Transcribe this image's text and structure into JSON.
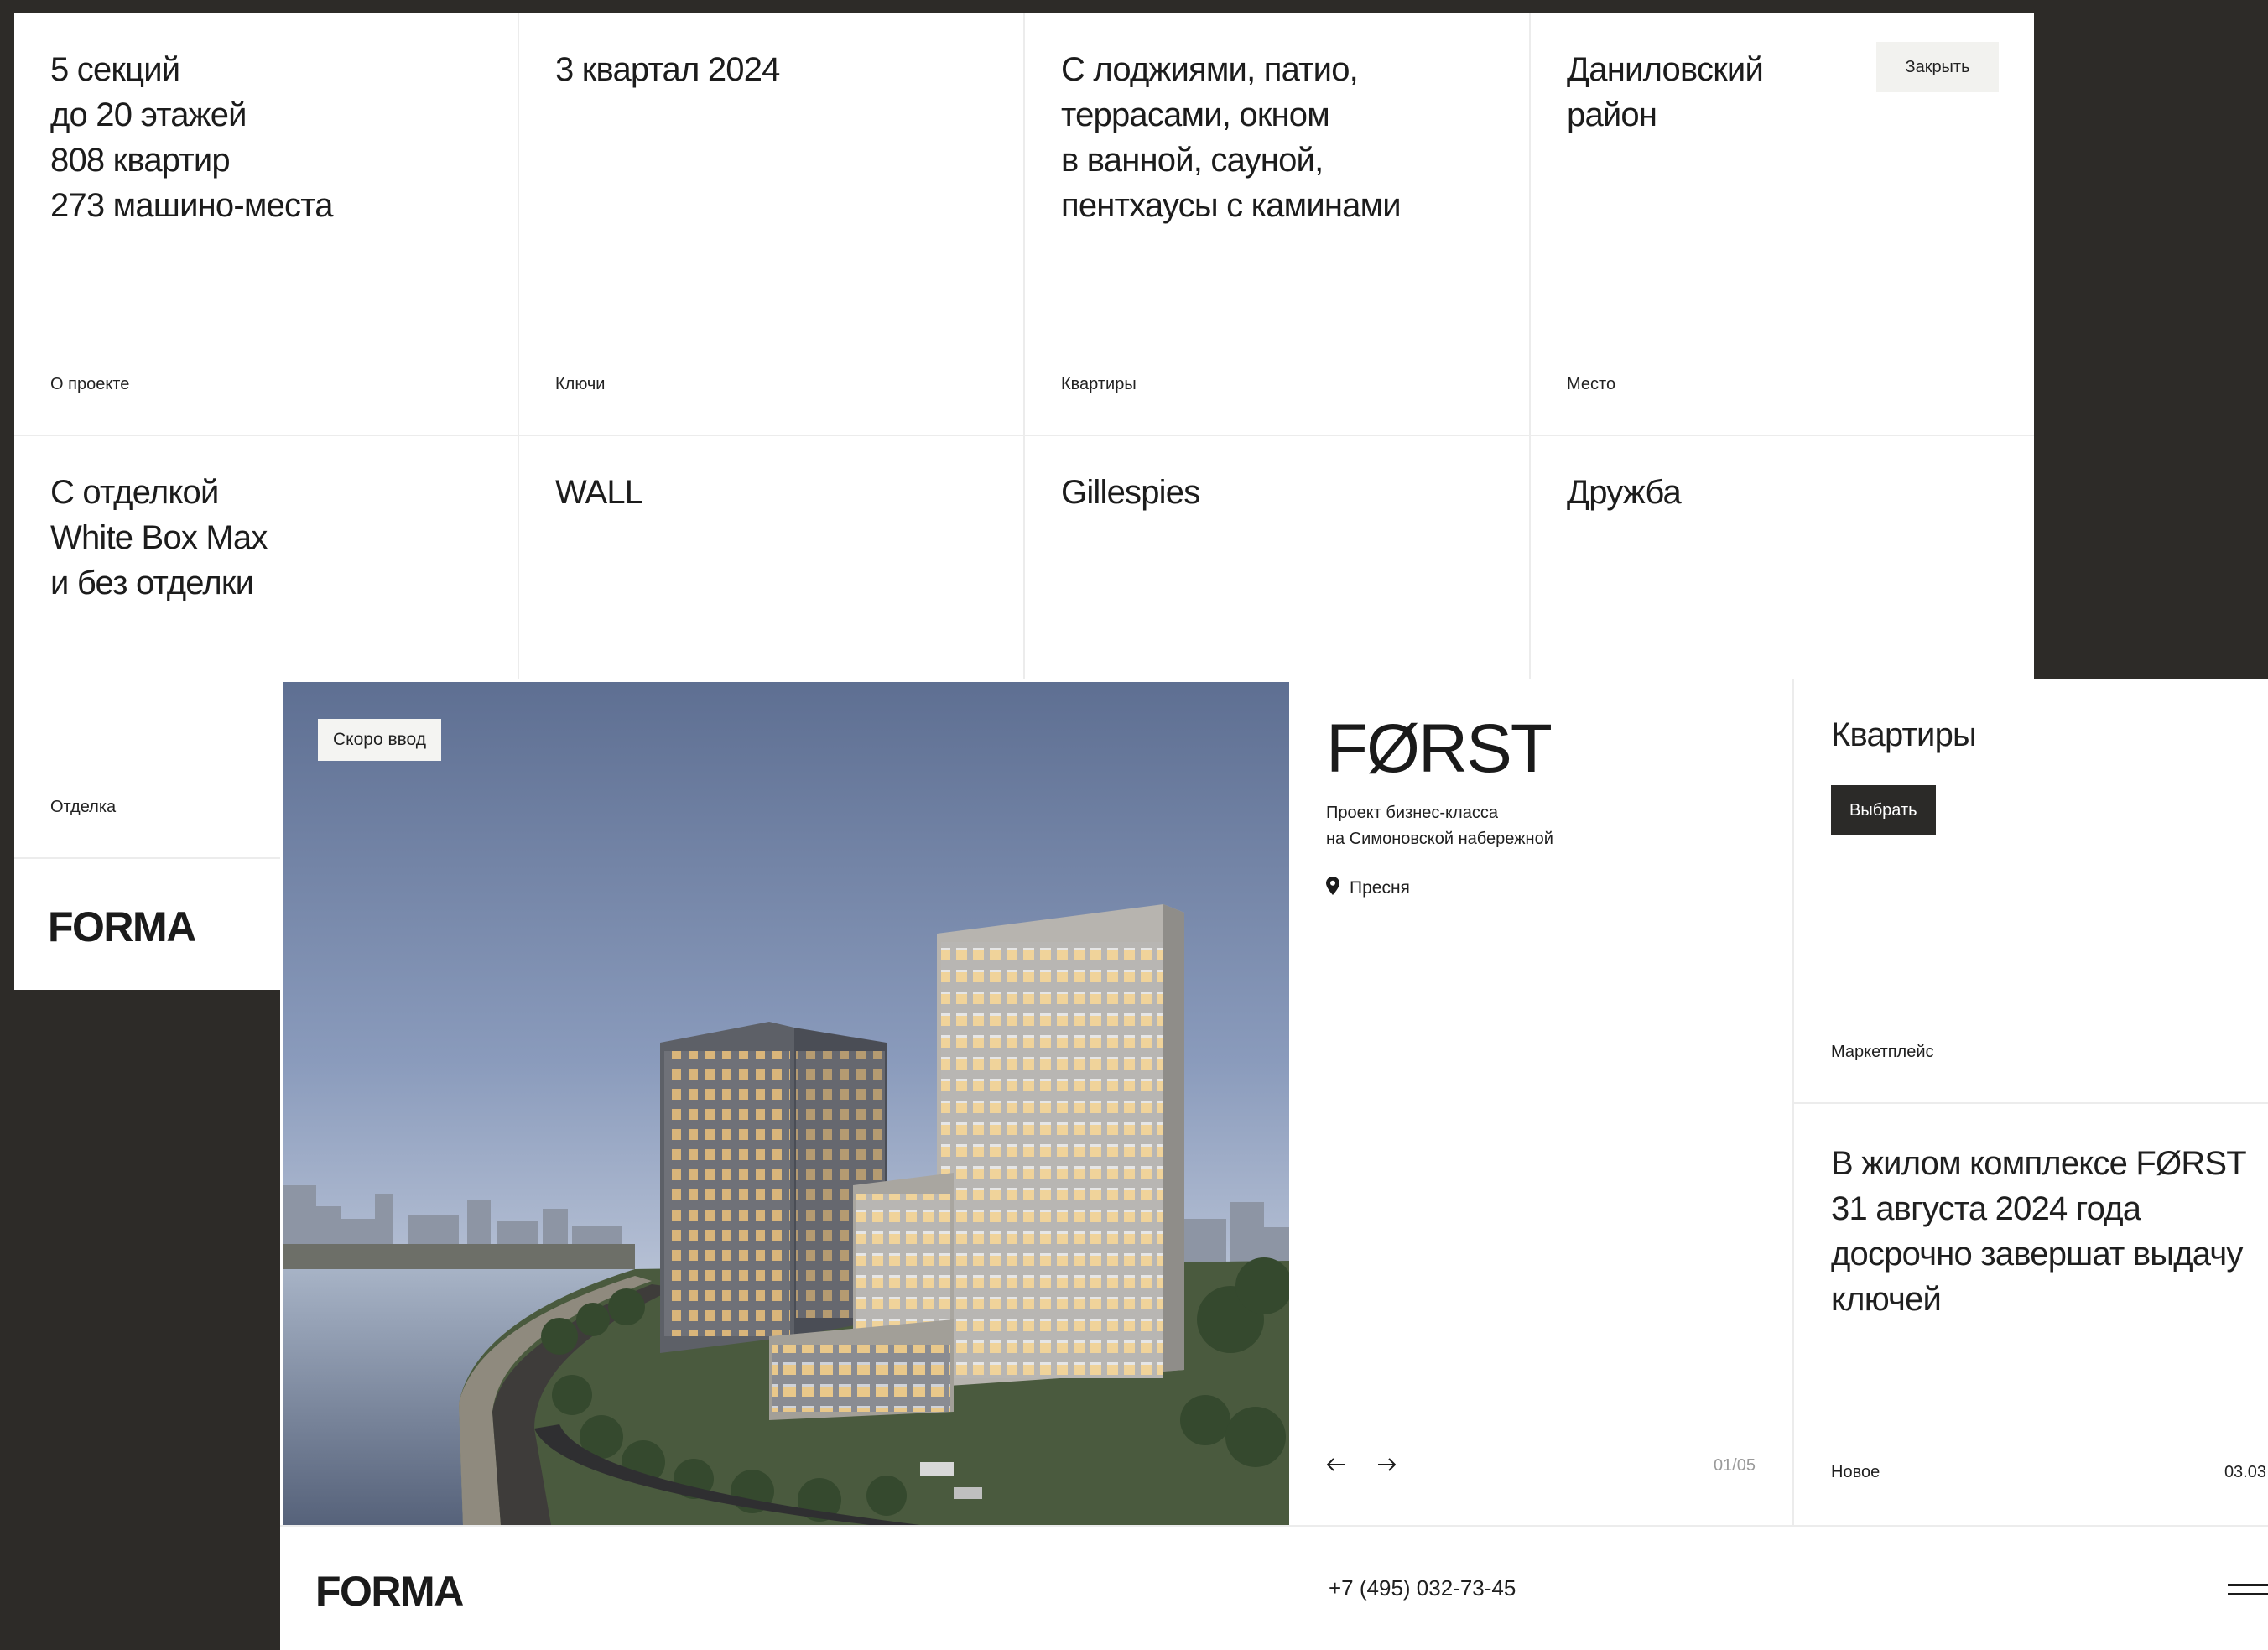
{
  "details": {
    "cells": [
      {
        "main": "5 секций\nдо 20 этажей\n808 квартир\n273 машино-места",
        "label": "О проекте"
      },
      {
        "main": "3  квартал 2024",
        "label": "Ключи"
      },
      {
        "main": "С лоджиями, патио,\nтеррасами, окном\nв ванной, сауной,\nпентхаусы с каминами",
        "label": "Квартиры"
      },
      {
        "main": "Даниловский\nрайон",
        "label": "Место"
      },
      {
        "main": "С отделкой\nWhite Box Max\nи без отделки",
        "label": "Отделка"
      },
      {
        "main": "WALL",
        "label": ""
      },
      {
        "main": "Gillespies",
        "label": ""
      },
      {
        "main": "Дружба",
        "label": ""
      }
    ],
    "close_label": "Закрыть",
    "logo": "FORMA"
  },
  "hero": {
    "badge": "Скоро ввод"
  },
  "project": {
    "name": "FØRST",
    "subtitle": "Проект бизнес-класса\nна Симоновской набережной",
    "location": "Пресня",
    "counter": "01/05"
  },
  "apartments": {
    "heading": "Квартиры",
    "button": "Выбрать",
    "label": "Маркетплейс"
  },
  "news": {
    "text": "В жилом комплексе FØRST 31 августа 2024 года досрочно завершат выдачу ключей",
    "tag": "Новое",
    "date": "03.03"
  },
  "footer": {
    "logo": "FORMA",
    "phone": "+7 (495) 032-73-45"
  },
  "icons": {
    "location": "map-pin-icon",
    "prev": "arrow-left-icon",
    "next": "arrow-right-icon",
    "menu": "menu-icon"
  },
  "colors": {
    "background": "#2d2b28",
    "panel": "#ffffff",
    "button_dark": "#2b2a28",
    "badge": "#f4f4f2",
    "divider": "#ececec",
    "counter": "#9a9a9a"
  }
}
